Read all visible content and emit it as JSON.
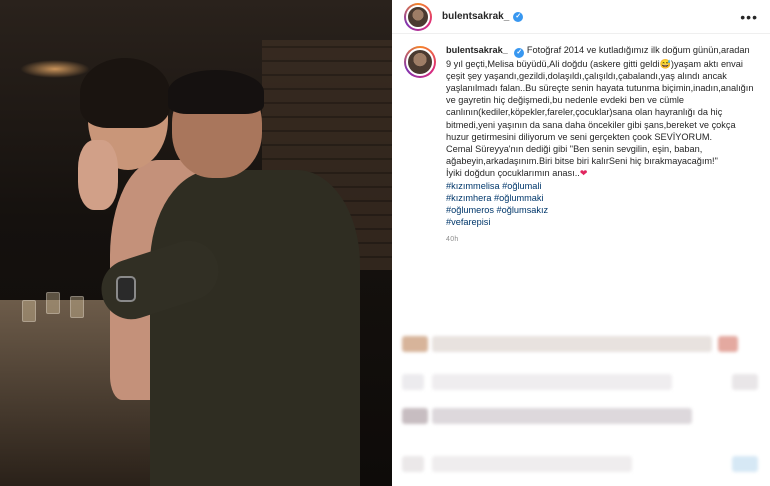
{
  "post": {
    "username": "bulentsakrak_",
    "verified_mark": "✓",
    "more_label": "•••"
  },
  "caption": {
    "username": "bulentsakrak_",
    "lines": [
      "Fotoğraf 2014 ve kutladığımız ilk doğum günün,aradan 9 yıl geçti,Melisa büyüdü,Ali doğdu (askere gitti geldi😅)yaşam aktı envai çeşit şey yaşandı,gezildi,dolaşıldı,çalışıldı,çabalandı,yaş alındı ancak yaşlanılmadı falan..Bu süreçte senin hayata tutunma biçimin,inadın,analığın ve gayretin hiç değişmedi,bu nedenle evdeki ben ve cümle canlının(kediler,köpekler,fareler,çocuklar)sana olan hayranlığı da hiç bitmedi,yeni yaşının da sana daha öncekiler gibi şans,bereket ve çokça huzur getirmesini diliyorum ve seni gerçekten çook SEVİYORUM.",
      "Cemal Süreyya'nın dediği gibi \"Ben senin sevgilin, eşin, baban, ağabeyin,arkadaşınım.Biri bitse biri kalırSeni hiç bırakmayacağım!\"",
      "İyiki doğdun çocuklarımın anası.."
    ],
    "heart": "❤",
    "hashtags": [
      "#kızımmelisa #oğlumali",
      "#kızımhera #oğlummaki",
      "#oğlumeros #oğlumsakız",
      "#vefarepisi"
    ],
    "time": "40h"
  },
  "icons": {
    "avatar": "profile-avatar-icon",
    "verified": "verified-badge-icon",
    "more": "more-options-icon"
  },
  "colors": {
    "link": "#00376b",
    "verified": "#3897f0",
    "heart": "#e0245e"
  }
}
